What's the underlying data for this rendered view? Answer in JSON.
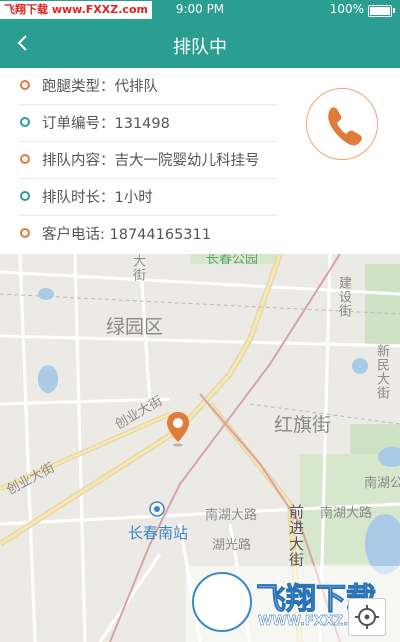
{
  "status_bar": {
    "watermark": "飞翔下载 www.FXXZ.com",
    "time": "9:00 PM",
    "battery": "100%"
  },
  "nav": {
    "title": "排队中",
    "back_icon": "chevron-left-icon"
  },
  "order_info": [
    {
      "text": "跑腿类型：代排队",
      "dot_color": "#e07b39"
    },
    {
      "text": "订单编号：131498",
      "dot_color": "#2a9e91"
    },
    {
      "text": "排队内容：吉大一院婴幼儿科挂号",
      "dot_color": "#e07b39"
    },
    {
      "text": "排队时长：1小时",
      "dot_color": "#2a9e91"
    },
    {
      "text": "客户电话: 18744165311",
      "dot_color": "#e07b39"
    }
  ],
  "call_icon": "phone-icon",
  "map": {
    "labels": {
      "district": "绿园区",
      "hongqi": "红旗街",
      "chuangye1": "创业大街",
      "chuangye2": "创业大街",
      "station": "长春南站",
      "nanhu1": "南湖大路",
      "nanhu2": "南湖大路",
      "huguang": "湖光路",
      "qianjin": "前进大街",
      "jianshe": "建设街",
      "xinmin": "新民大街",
      "nanhu_park": "南湖公",
      "changchun_park": "长春公园",
      "dajie_top": "大街"
    }
  },
  "watermark_corner": {
    "name": "飞翔下载",
    "url": "WWW.FXXZ.COM"
  },
  "colors": {
    "primary": "#2a9e91",
    "accent": "#e07b39"
  }
}
